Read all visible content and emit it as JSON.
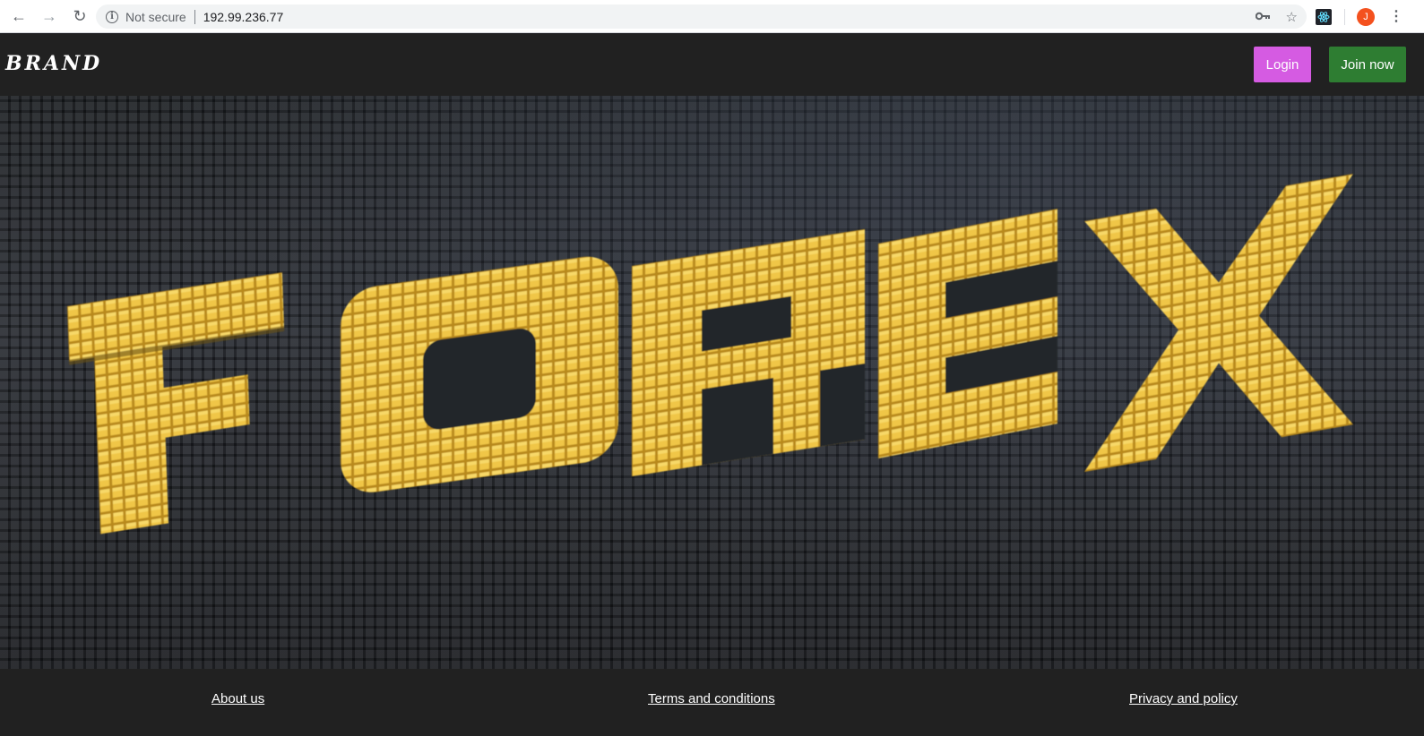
{
  "browser": {
    "security_label": "Not secure",
    "url": "192.99.236.77",
    "avatar_letter": "J"
  },
  "header": {
    "brand": "BRAND",
    "login_label": "Login",
    "join_label": "Join now",
    "login_color": "#d55be2",
    "join_color": "#2e7d32"
  },
  "hero": {
    "word": "FOREX",
    "letter_color": "#e8b83a"
  },
  "footer": {
    "about": "About us",
    "terms": "Terms and conditions",
    "privacy": "Privacy and policy"
  }
}
